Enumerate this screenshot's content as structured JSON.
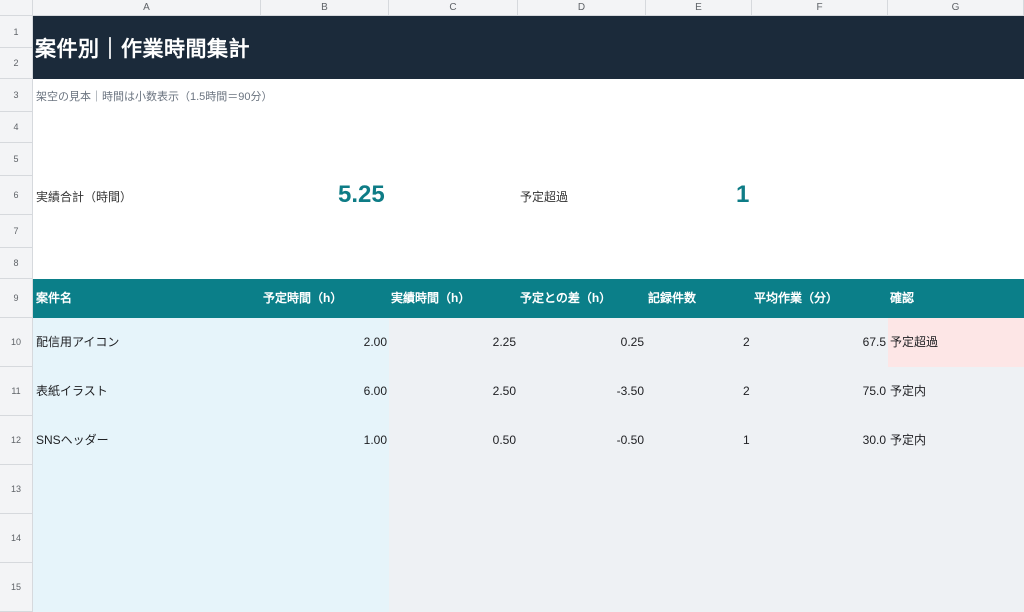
{
  "columns": [
    "A",
    "B",
    "C",
    "D",
    "E",
    "F",
    "G"
  ],
  "rows": [
    "1",
    "2",
    "3",
    "4",
    "5",
    "6",
    "7",
    "8",
    "9",
    "10",
    "11",
    "12",
    "13",
    "14",
    "15"
  ],
  "title": "案件別｜作業時間集計",
  "subtitle": "架空の見本｜時間は小数表示（1.5時間＝90分）",
  "kpis": {
    "actual_label": "実績合計（時間）",
    "actual_value": "5.25",
    "over_label": "予定超過",
    "over_value": "1"
  },
  "table": {
    "headers": [
      "案件名",
      "予定時間（h）",
      "実績時間（h）",
      "予定との差（h）",
      "記録件数",
      "平均作業（分）",
      "確認"
    ],
    "rows": [
      {
        "name": "配信用アイコン",
        "planned": "2.00",
        "actual": "2.25",
        "diff": "0.25",
        "count": "2",
        "avg": "67.5",
        "status": "予定超過"
      },
      {
        "name": "表紙イラスト",
        "planned": "6.00",
        "actual": "2.50",
        "diff": "-3.50",
        "count": "2",
        "avg": "75.0",
        "status": "予定内"
      },
      {
        "name": "SNSヘッダー",
        "planned": "1.00",
        "actual": "0.50",
        "diff": "-0.50",
        "count": "1",
        "avg": "30.0",
        "status": "予定内"
      }
    ]
  },
  "colors": {
    "title_band": "#1b2a3a",
    "table_header": "#0b7f89",
    "kpi_value": "#0e7c86",
    "name_column_fill": "#e6f4fa",
    "data_area_fill": "#eef1f4",
    "over_highlight": "#fde6e6"
  }
}
